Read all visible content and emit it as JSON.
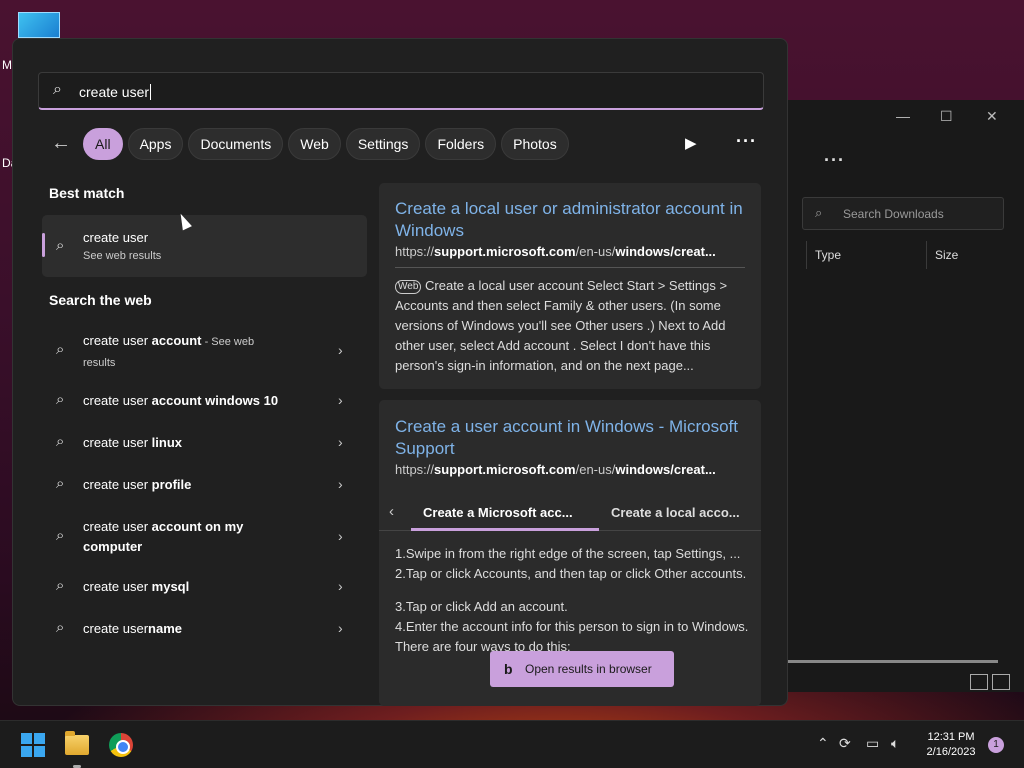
{
  "desktop": {
    "left_text_1": "M",
    "left_text_2": "Da"
  },
  "explorer": {
    "minimize": "—",
    "maximize": "☐",
    "close": "✕",
    "search_placeholder": "Search Downloads",
    "columns": [
      "Type",
      "Size"
    ]
  },
  "search": {
    "query": "create user",
    "filters": [
      "All",
      "Apps",
      "Documents",
      "Web",
      "Settings",
      "Folders",
      "Photos"
    ],
    "active_filter": "All"
  },
  "best_match": {
    "heading": "Best match",
    "title": "create user",
    "subtitle": "See web results"
  },
  "search_web": {
    "heading": "Search the web",
    "items": [
      {
        "prefix": "create user",
        "bold": " account",
        "suffix": " - See web",
        "sub": "results"
      },
      {
        "prefix": "create user",
        "bold": " account windows 10",
        "suffix": "",
        "sub": ""
      },
      {
        "prefix": "create user",
        "bold": " linux",
        "suffix": "",
        "sub": ""
      },
      {
        "prefix": "create user",
        "bold": " profile",
        "suffix": "",
        "sub": ""
      },
      {
        "prefix": "create user",
        "bold": " account on my",
        "suffix": "",
        "sub": "computer"
      },
      {
        "prefix": "create user",
        "bold": " mysql",
        "suffix": "",
        "sub": ""
      },
      {
        "prefix": "create user",
        "bold": "name",
        "suffix": "",
        "sub": ""
      }
    ]
  },
  "card1": {
    "title": "Create a local user or administrator account in Windows",
    "url_pre": "https://",
    "url_bold1": "support.microsoft.com",
    "url_mid": "/en-us/",
    "url_bold2": "windows/creat...",
    "web_tag": "Web",
    "body": "Create a local user account Select Start > Settings > Accounts and then select Family & other users. (In some versions of Windows you'll see Other users .) Next to Add other user, select Add account . Select I don't have this person's sign-in information, and on the next page..."
  },
  "card2": {
    "title": "Create a user account in Windows - Microsoft Support",
    "url_pre": "https://",
    "url_bold1": "support.microsoft.com",
    "url_mid": "/en-us/",
    "url_bold2": "windows/creat...",
    "tab1": "Create a Microsoft acc...",
    "tab2": "Create a local acco...",
    "step1": "1.Swipe in from the right edge of the screen, tap Settings, ...",
    "step2": "2.Tap or click Accounts, and then tap or click Other accounts.",
    "step3": "3.Tap or click Add an account.",
    "step4": "4.Enter the account info for this person to sign in to Windows. There are four ways to do this:"
  },
  "open_browser": {
    "label": "Open results in browser",
    "icon": "b"
  },
  "taskbar": {
    "time": "12:31 PM",
    "date": "2/16/2023",
    "notifications": "1"
  }
}
